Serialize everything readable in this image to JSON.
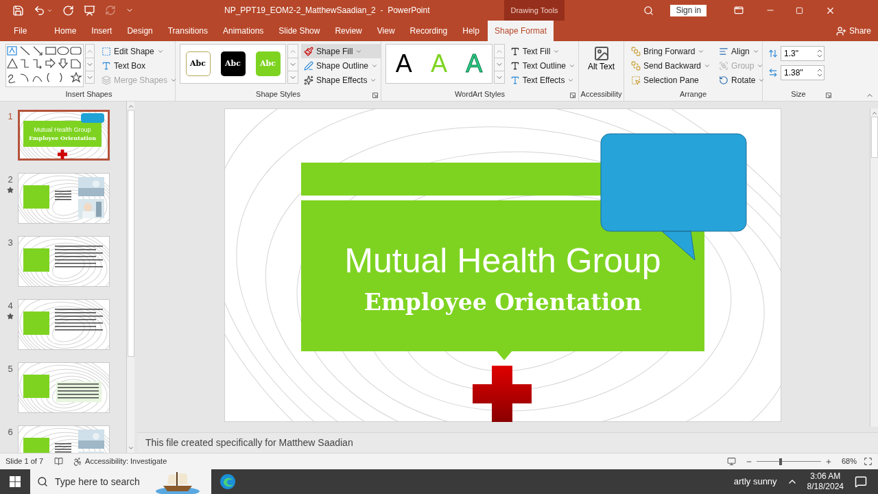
{
  "title_bar": {
    "title": "NP_PPT19_EOM2-2_MatthewSaadian_2  -  PowerPoint",
    "contextual_tab": "Drawing Tools",
    "sign_in": "Sign in"
  },
  "tabs": [
    {
      "label": "File",
      "selected": false
    },
    {
      "label": "Home",
      "selected": false
    },
    {
      "label": "Insert",
      "selected": false
    },
    {
      "label": "Design",
      "selected": false
    },
    {
      "label": "Transitions",
      "selected": false
    },
    {
      "label": "Animations",
      "selected": false
    },
    {
      "label": "Slide Show",
      "selected": false
    },
    {
      "label": "Review",
      "selected": false
    },
    {
      "label": "View",
      "selected": false
    },
    {
      "label": "Recording",
      "selected": false
    },
    {
      "label": "Help",
      "selected": false
    },
    {
      "label": "Shape Format",
      "selected": true
    }
  ],
  "share": "Share",
  "ribbon": {
    "insert_shapes": {
      "label": "Insert Shapes",
      "commands": [
        {
          "label": "Edit Shape",
          "disabled": false
        },
        {
          "label": "Text Box",
          "disabled": false
        },
        {
          "label": "Merge Shapes",
          "disabled": true
        }
      ]
    },
    "shape_styles": {
      "label": "Shape Styles",
      "presets": [
        {
          "label": "Abc",
          "kind": "outline",
          "color": "#ffffff"
        },
        {
          "label": "Abc",
          "kind": "filled",
          "color": "#000000"
        },
        {
          "label": "Abc",
          "kind": "filled",
          "color": "#7ed321"
        }
      ],
      "commands": [
        {
          "label": "Shape Fill",
          "selected": true
        },
        {
          "label": "Shape Outline",
          "selected": false
        },
        {
          "label": "Shape Effects",
          "selected": false
        }
      ]
    },
    "wordart_styles": {
      "label": "WordArt Styles",
      "presets": [
        {
          "label": "A",
          "kind": "solid",
          "color": "#000000"
        },
        {
          "label": "A",
          "kind": "solid",
          "color": "#7ed321"
        },
        {
          "label": "A",
          "kind": "outline",
          "color": "#2ecf8a"
        }
      ],
      "commands": [
        {
          "label": "Text Fill"
        },
        {
          "label": "Text Outline"
        },
        {
          "label": "Text Effects"
        }
      ]
    },
    "accessibility": {
      "label": "Accessibility",
      "button": "Alt Text"
    },
    "arrange": {
      "label": "Arrange",
      "commands": [
        {
          "label": "Bring Forward",
          "disabled": false
        },
        {
          "label": "Send Backward",
          "disabled": false
        },
        {
          "label": "Selection Pane",
          "disabled": false
        },
        {
          "label": "Align",
          "disabled": false
        },
        {
          "label": "Group",
          "disabled": true
        },
        {
          "label": "Rotate",
          "disabled": false
        }
      ]
    },
    "size": {
      "label": "Size",
      "height": "1.3\"",
      "width": "1.38\""
    }
  },
  "thumbnails": [
    {
      "number": "1",
      "selected": true,
      "starred": false,
      "kind": "title",
      "title": "Mutual Health Group",
      "subtitle": "Employee Orientation"
    },
    {
      "number": "2",
      "selected": false,
      "starred": true,
      "kind": "pictures"
    },
    {
      "number": "3",
      "selected": false,
      "starred": false,
      "kind": "text"
    },
    {
      "number": "4",
      "selected": false,
      "starred": true,
      "kind": "text"
    },
    {
      "number": "5",
      "selected": false,
      "starred": false,
      "kind": "table"
    },
    {
      "number": "6",
      "selected": false,
      "starred": false,
      "kind": "pictures"
    }
  ],
  "slide": {
    "title": "Mutual Health Group",
    "subtitle": "Employee Orientation"
  },
  "notes": "This file created specifically for Matthew Saadian",
  "status_bar": {
    "slide_indicator": "Slide 1 of 7",
    "accessibility": "Accessibility: Investigate",
    "zoom": {
      "level": 0.35,
      "reading": "68%"
    }
  },
  "taskbar": {
    "search_placeholder": "Type here to search",
    "weather": "artly sunny",
    "time": "3:06 AM",
    "date": "8/18/2024"
  }
}
